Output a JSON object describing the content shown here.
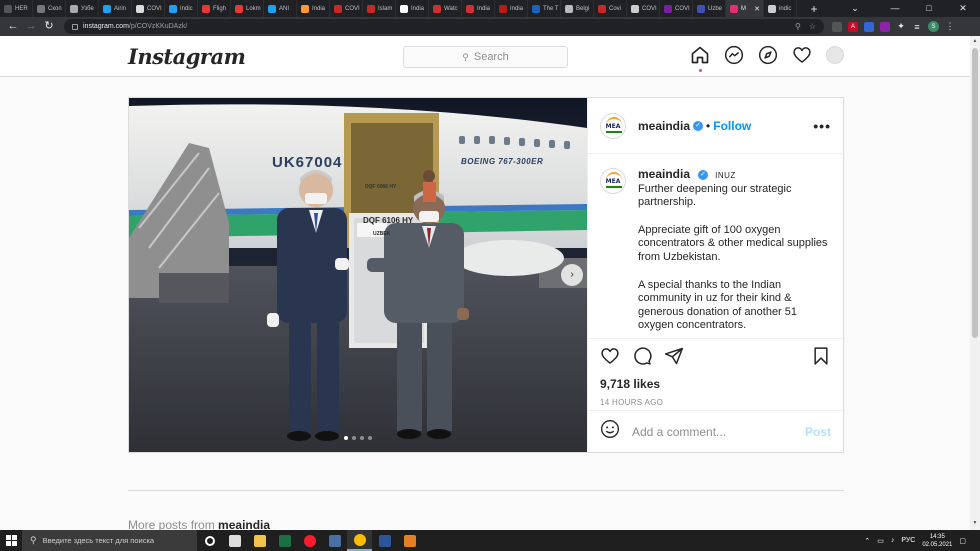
{
  "browser": {
    "tabs": [
      {
        "label": "HER",
        "color": "#555"
      },
      {
        "label": "Скоп",
        "color": "#777"
      },
      {
        "label": "Узбе",
        "color": "#aaa"
      },
      {
        "label": "Airin",
        "color": "#1da1f2"
      },
      {
        "label": "COVI",
        "color": "#ddd"
      },
      {
        "label": "Indic",
        "color": "#1da1f2"
      },
      {
        "label": "Fligh",
        "color": "#e53935"
      },
      {
        "label": "Lokm",
        "color": "#e53935"
      },
      {
        "label": "ANI",
        "color": "#1da1f2"
      },
      {
        "label": "India",
        "color": "#ff9933"
      },
      {
        "label": "COVI",
        "color": "#c62828"
      },
      {
        "label": "Islam",
        "color": "#c62828"
      },
      {
        "label": "India",
        "color": "#fff"
      },
      {
        "label": "Watc",
        "color": "#d32f2f"
      },
      {
        "label": "India",
        "color": "#d32f2f"
      },
      {
        "label": "India",
        "color": "#b71c1c"
      },
      {
        "label": "The T",
        "color": "#1565c0"
      },
      {
        "label": "Belgi",
        "color": "#bbb"
      },
      {
        "label": "Covi",
        "color": "#c62828"
      },
      {
        "label": "COVI",
        "color": "#ccc"
      },
      {
        "label": "COVI",
        "color": "#7b1fa2"
      },
      {
        "label": "Uzbe",
        "color": "#3f51b5"
      },
      {
        "label": "М",
        "color": "#e1306c",
        "active": true
      },
      {
        "label": "indic",
        "color": "#ccc"
      }
    ],
    "window_controls": [
      "—",
      "□",
      "✕"
    ],
    "url_host": "instagram.com",
    "url_path": "/p/COVzKKuDAzk/",
    "profile_letter": "S"
  },
  "instagram": {
    "logo": "Instagram",
    "search_placeholder": "Search"
  },
  "post": {
    "username": "meaindia",
    "follow_label": "Follow",
    "dot": "•",
    "more_label": "•••",
    "caption_username": "meaindia",
    "caption_tag": "🇮🇳 🇺🇿",
    "caption_tag_text": "INUZ",
    "caption_paragraphs": [
      "Further deepening our strategic partnership.",
      "Appreciate gift of 100 oxygen concentrators & other medical supplies from Uzbekistan.",
      "A special thanks to the Indian community in uz for their kind & generous donation of another 51 oxygen concentrators."
    ],
    "likes": "9,718 likes",
    "time": "14 HOURS AGO",
    "comment_placeholder": "Add a comment...",
    "post_button": "Post",
    "photo": {
      "registration": "UK67004",
      "aircraft_type": "BOEING 767-300ER",
      "cargo_label_1": "DQF 6066 HY",
      "cargo_label_2": "DQF 6106 HY",
      "cargo_label_3": "UZBEK",
      "carousel_total": 4,
      "carousel_index": 1
    }
  },
  "more_posts": {
    "prefix": "More posts from",
    "username": "meaindia"
  },
  "taskbar": {
    "search_placeholder": "Введите здесь текст для поиска",
    "language": "РУС",
    "time": "14:35",
    "date": "02.05.2021",
    "apps": [
      {
        "name": "cortana",
        "color": "#fff",
        "round": true
      },
      {
        "name": "task-view",
        "color": "#ddd"
      },
      {
        "name": "store",
        "color": "#f2c14e"
      },
      {
        "name": "excel",
        "color": "#1d6f42"
      },
      {
        "name": "opera",
        "color": "#ff1b2d",
        "round": true
      },
      {
        "name": "calculator",
        "color": "#4a6fa5"
      },
      {
        "name": "chrome",
        "color": "#fbbc05",
        "round": true,
        "active": true
      },
      {
        "name": "word",
        "color": "#2b579a"
      },
      {
        "name": "app",
        "color": "#e67e22"
      }
    ]
  }
}
